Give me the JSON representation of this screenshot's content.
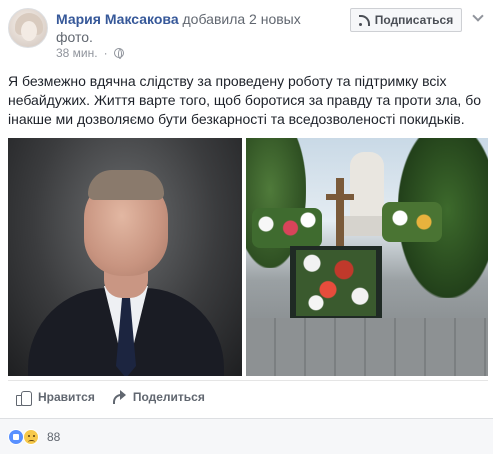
{
  "post": {
    "author": "Мария Максакова",
    "action": "добавила 2 новых фото.",
    "time": "38 мин.",
    "privacy_icon": "globe-icon",
    "text": "Я безмежно вдячна слідству за проведену роботу та підтримку всіх небайдужих. Життя варте того, щоб боротися за правду та проти зла, бо інакше ми дозволяємо бути безкарності та вседозволеності покидьків."
  },
  "header": {
    "subscribe_label": "Подписаться"
  },
  "photos": [
    {
      "subject": "portrait"
    },
    {
      "subject": "cemetery"
    }
  ],
  "actions": {
    "like_label": "Нравится",
    "share_label": "Поделиться"
  },
  "reactions": {
    "count": "88",
    "icons": [
      "like-reaction-icon",
      "sad-reaction-icon"
    ]
  },
  "colors": {
    "author_link": "#365899",
    "meta_gray": "#90949c",
    "action_gray": "#616770",
    "like_blue": "#5890ff",
    "sad_yellow": "#f7c94b"
  }
}
